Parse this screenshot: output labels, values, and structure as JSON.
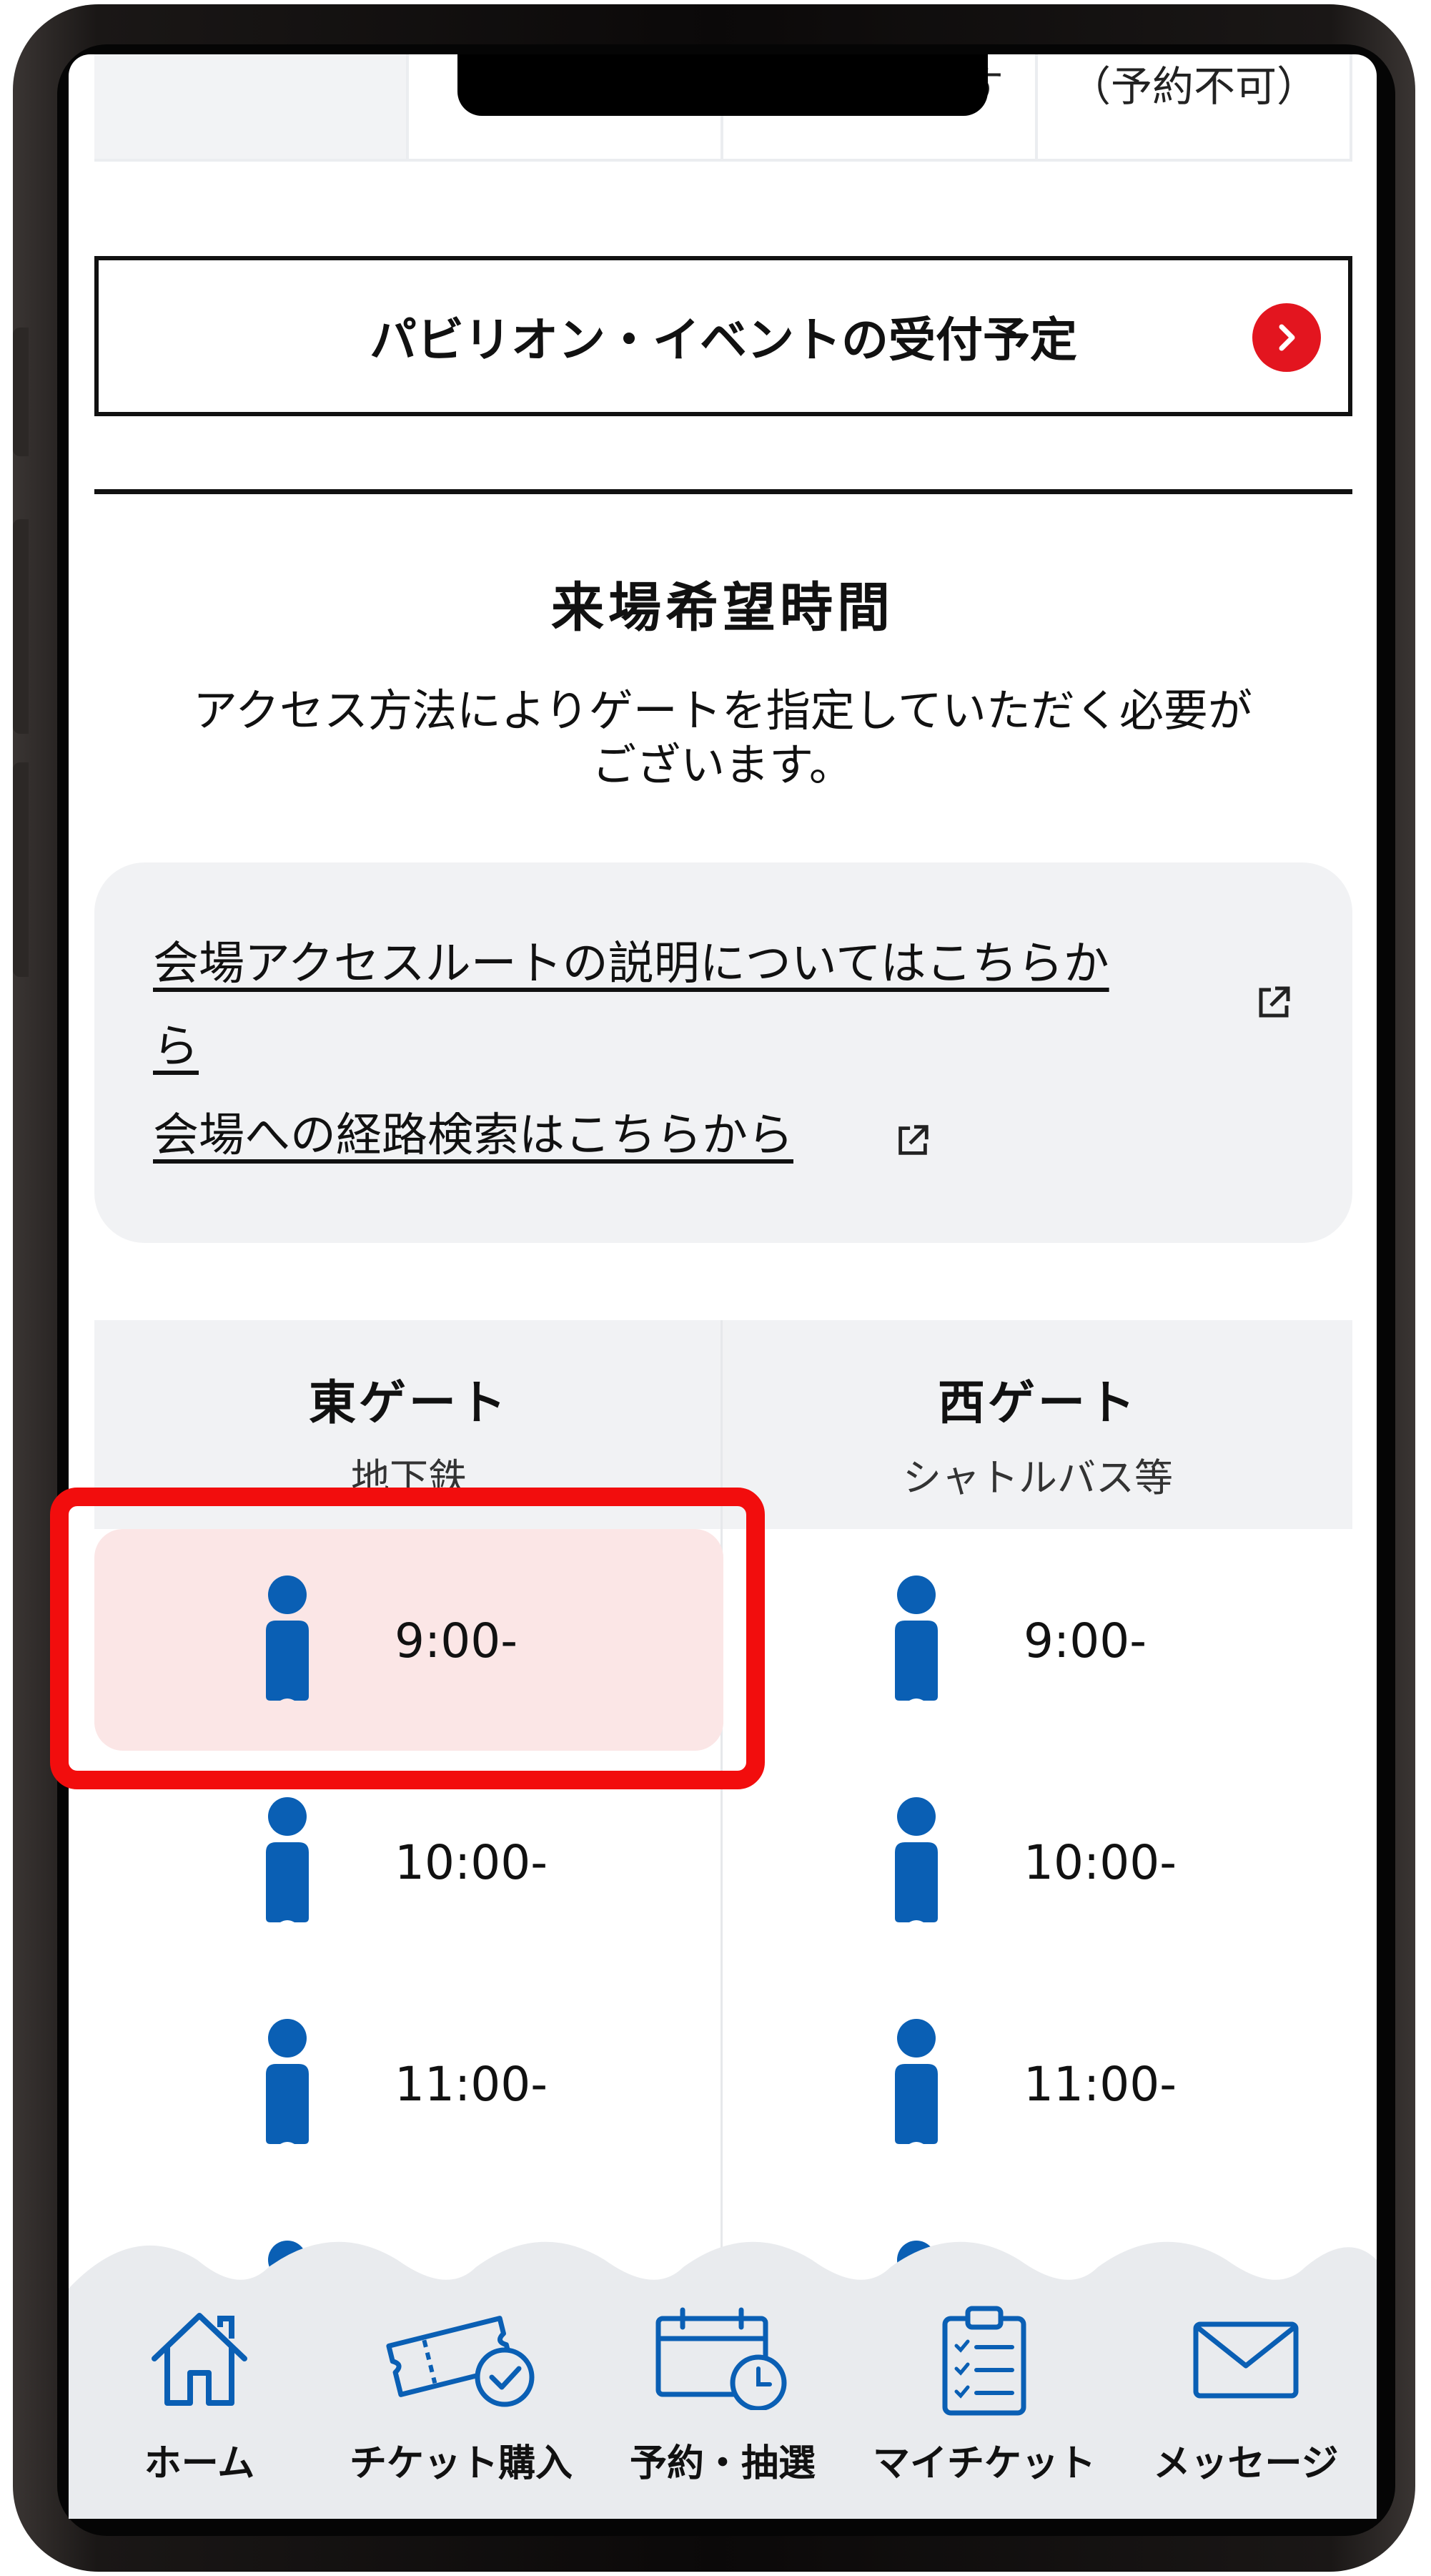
{
  "top_table": {
    "cells": [
      "",
      "",
      "予想されます",
      "（予約不可）"
    ]
  },
  "pavilion_button": {
    "label": "パビリオン・イベントの受付予定"
  },
  "section": {
    "title": "来場希望時間",
    "description_line1": "アクセス方法によりゲートを指定していただく必要が",
    "description_line2": "ございます。"
  },
  "links": {
    "route_line1": "会場アクセスルートの説明についてはこちらか",
    "route_line2": "ら",
    "search": "会場への経路検索はこちらから"
  },
  "gates": [
    {
      "name": "東ゲート",
      "sub": "地下鉄",
      "slots": [
        {
          "time": "9:00-",
          "selected": true
        },
        {
          "time": "10:00-",
          "selected": false
        },
        {
          "time": "11:00-",
          "selected": false
        }
      ]
    },
    {
      "name": "西ゲート",
      "sub": "シャトルバス等",
      "slots": [
        {
          "time": "9:00-",
          "selected": false
        },
        {
          "time": "10:00-",
          "selected": false
        },
        {
          "time": "11:00-",
          "selected": false
        }
      ]
    }
  ],
  "nav": {
    "items": [
      {
        "label": "ホーム",
        "icon": "home-icon"
      },
      {
        "label": "チケット購入",
        "icon": "ticket-icon"
      },
      {
        "label": "予約・抽選",
        "icon": "calendar-clock-icon"
      },
      {
        "label": "マイチケット",
        "icon": "clipboard-icon"
      },
      {
        "label": "メッセージ",
        "icon": "mail-icon"
      }
    ]
  },
  "colors": {
    "accent_blue": "#0a5fb4",
    "highlight_red": "#f20d0d",
    "selected_bg": "#fbe6e6",
    "chevron_red": "#e3151f",
    "panel_gray": "#f1f2f4"
  }
}
